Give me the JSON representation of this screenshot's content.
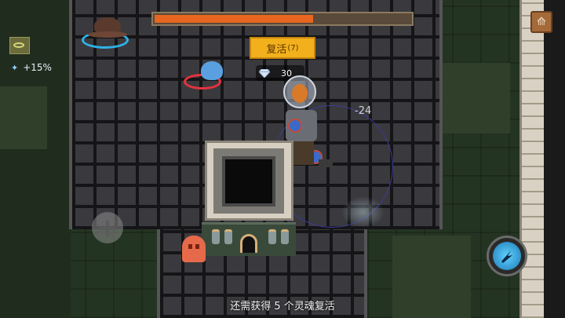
{
  "hud": {
    "boss_health_fraction": 0.62,
    "revive_button": {
      "label": "复活",
      "cost": "(7)"
    },
    "gems": {
      "count": "30"
    },
    "buff": {
      "text": "+15%"
    },
    "damage_number": "-24",
    "hint": "还需获得 5 个灵魂复活"
  },
  "icons": {
    "pause": "pause-icon",
    "joystick": "plus-icon",
    "skill": "skill-icon",
    "gem": "diamond-icon"
  },
  "colors": {
    "health": "#e8661f",
    "revive_button": "#f2b11c",
    "enemy_ring_blue": "#2fb2e8",
    "enemy_ring_red": "#e8323c"
  }
}
